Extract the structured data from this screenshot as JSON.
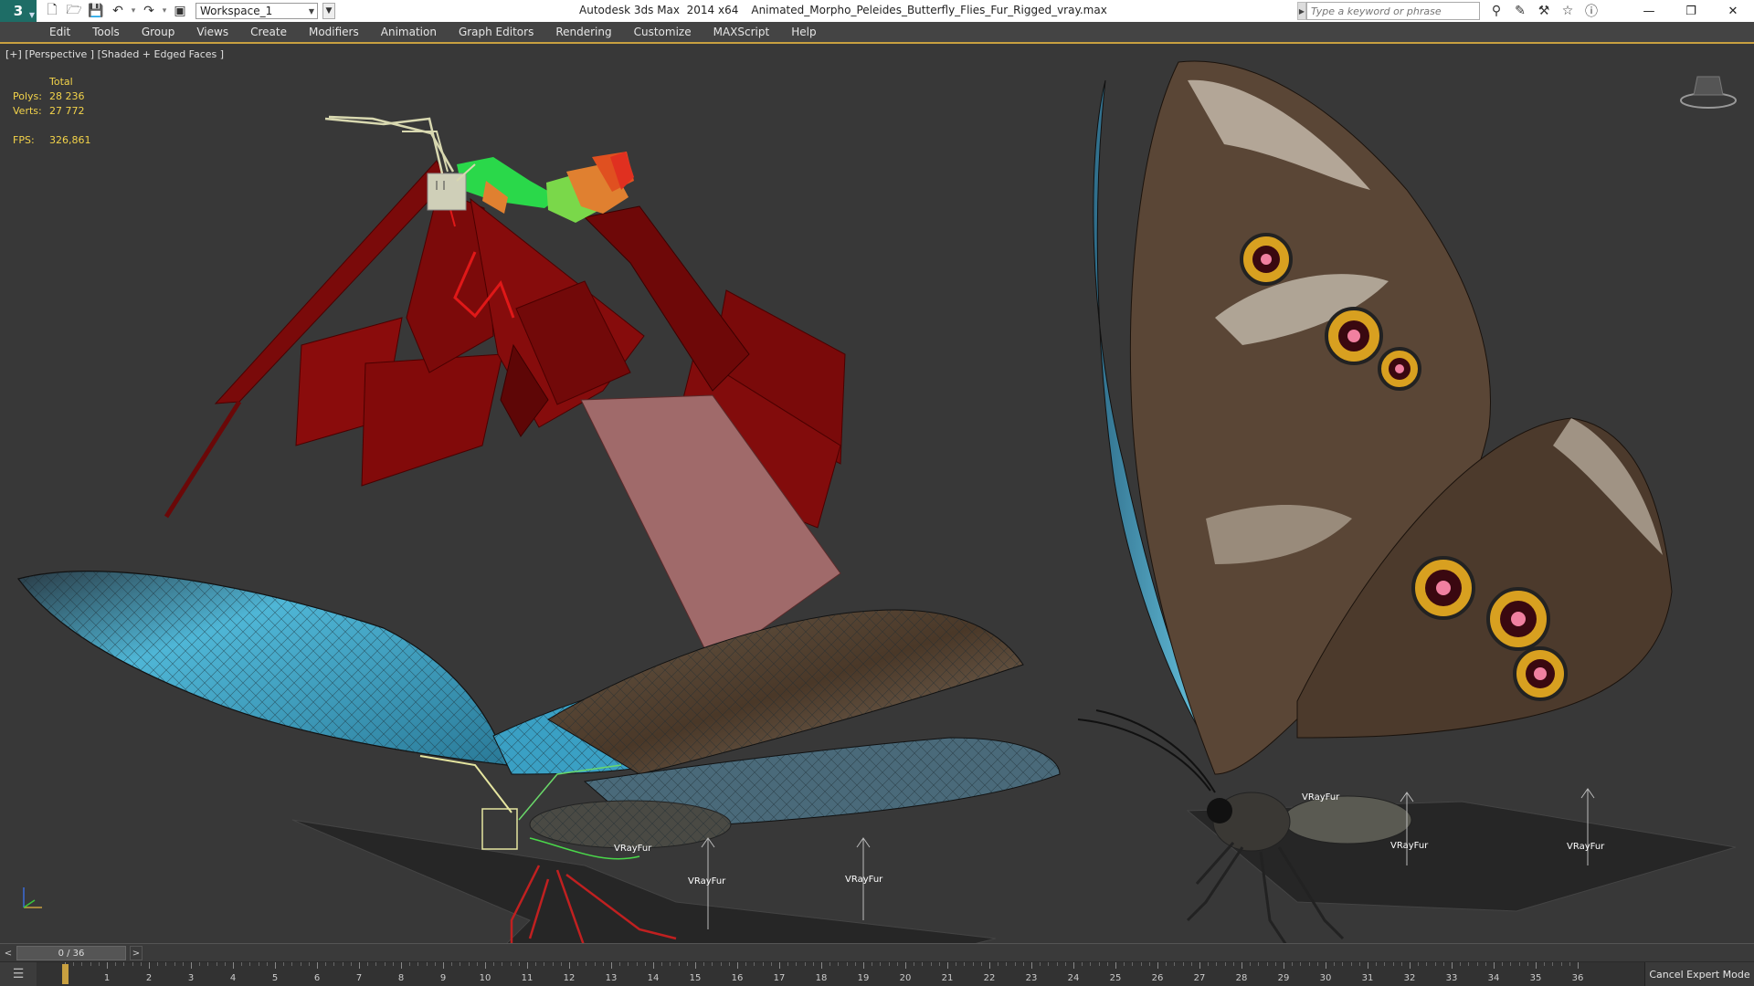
{
  "app": {
    "logo": "3",
    "name": "Autodesk 3ds Max  2014 x64",
    "file": "Animated_Morpho_Peleides_Butterfly_Flies_Fur_Rigged_vray.max"
  },
  "quick_access": {
    "workspace": "Workspace_1",
    "icons": [
      "new-file-icon",
      "open-file-icon",
      "save-icon",
      "undo-icon",
      "redo-icon",
      "project-folder-icon"
    ]
  },
  "search": {
    "placeholder": "Type a keyword or phrase"
  },
  "menu": [
    "Edit",
    "Tools",
    "Group",
    "Views",
    "Create",
    "Modifiers",
    "Animation",
    "Graph Editors",
    "Rendering",
    "Customize",
    "MAXScript",
    "Help"
  ],
  "viewport": {
    "label": "[+] [Perspective ] [Shaded + Edged Faces ]",
    "stats": {
      "header": "Total",
      "polys_label": "Polys:",
      "polys": "28 236",
      "verts_label": "Verts:",
      "verts": "27 772",
      "fps_label": "FPS:",
      "fps": "326,861"
    },
    "fur_labels": [
      "VRayFur",
      "VRayFur",
      "VRayFur",
      "VRayFur",
      "VRayFur",
      "VRayFur"
    ]
  },
  "timeline": {
    "prev": "<",
    "frame": "0 / 36",
    "next": ">",
    "ticks": [
      "0",
      "1",
      "2",
      "3",
      "4",
      "5",
      "6",
      "7",
      "8",
      "9",
      "10",
      "11",
      "12",
      "13",
      "14",
      "15",
      "16",
      "17",
      "18",
      "19",
      "20",
      "21",
      "22",
      "23",
      "24",
      "25",
      "26",
      "27",
      "28",
      "29",
      "30",
      "31",
      "32",
      "33",
      "34",
      "35",
      "36"
    ]
  },
  "status": {
    "cancel_expert": "Cancel Expert Mode"
  },
  "colors": {
    "accent": "#c8a040",
    "stats": "#f3d34a",
    "menubar": "#444444",
    "viewport": "#383838"
  }
}
